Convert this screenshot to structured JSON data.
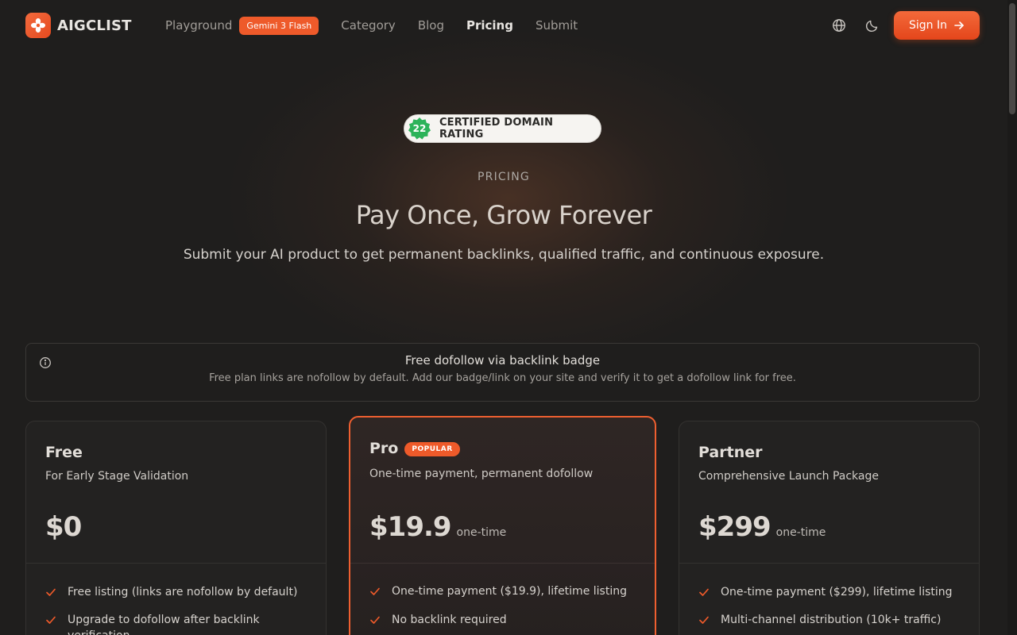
{
  "colors": {
    "accent": "#ee5a2a",
    "background": "#1f1e1d",
    "dr_seal": "#2db35a"
  },
  "header": {
    "logo_text": "AIGCLIST",
    "nav": {
      "playground": "Playground",
      "playground_badge": "Gemini 3 Flash",
      "category": "Category",
      "blog": "Blog",
      "pricing": "Pricing",
      "submit": "Submit"
    },
    "icons": {
      "language": "globe-icon",
      "theme": "moon-icon"
    },
    "sign_in": "Sign In"
  },
  "hero": {
    "domain_rating": "22",
    "domain_rating_label": "CERTIFIED DOMAIN RATING",
    "eyebrow": "PRICING",
    "title": "Pay Once, Grow Forever",
    "subtitle": "Submit your AI product to get permanent backlinks, qualified traffic, and continuous exposure."
  },
  "notice": {
    "title": "Free dofollow via backlink badge",
    "text": "Free plan links are nofollow by default. Add our badge/link on your site and verify it to get a dofollow link for free."
  },
  "plans": [
    {
      "name": "Free",
      "subtitle": "For Early Stage Validation",
      "price": "$0",
      "unit": "",
      "features": [
        "Free listing (links are nofollow by default)",
        "Upgrade to dofollow after backlink verification"
      ]
    },
    {
      "name": "Pro",
      "badge": "POPULAR",
      "subtitle": "One-time payment, permanent dofollow",
      "price": "$19.9",
      "unit": "one-time",
      "features": [
        "One-time payment ($19.9), lifetime listing",
        "No backlink required"
      ]
    },
    {
      "name": "Partner",
      "subtitle": "Comprehensive Launch Package",
      "price": "$299",
      "unit": "one-time",
      "features": [
        "One-time payment ($299), lifetime listing",
        "Multi-channel distribution (10k+ traffic)"
      ]
    }
  ]
}
